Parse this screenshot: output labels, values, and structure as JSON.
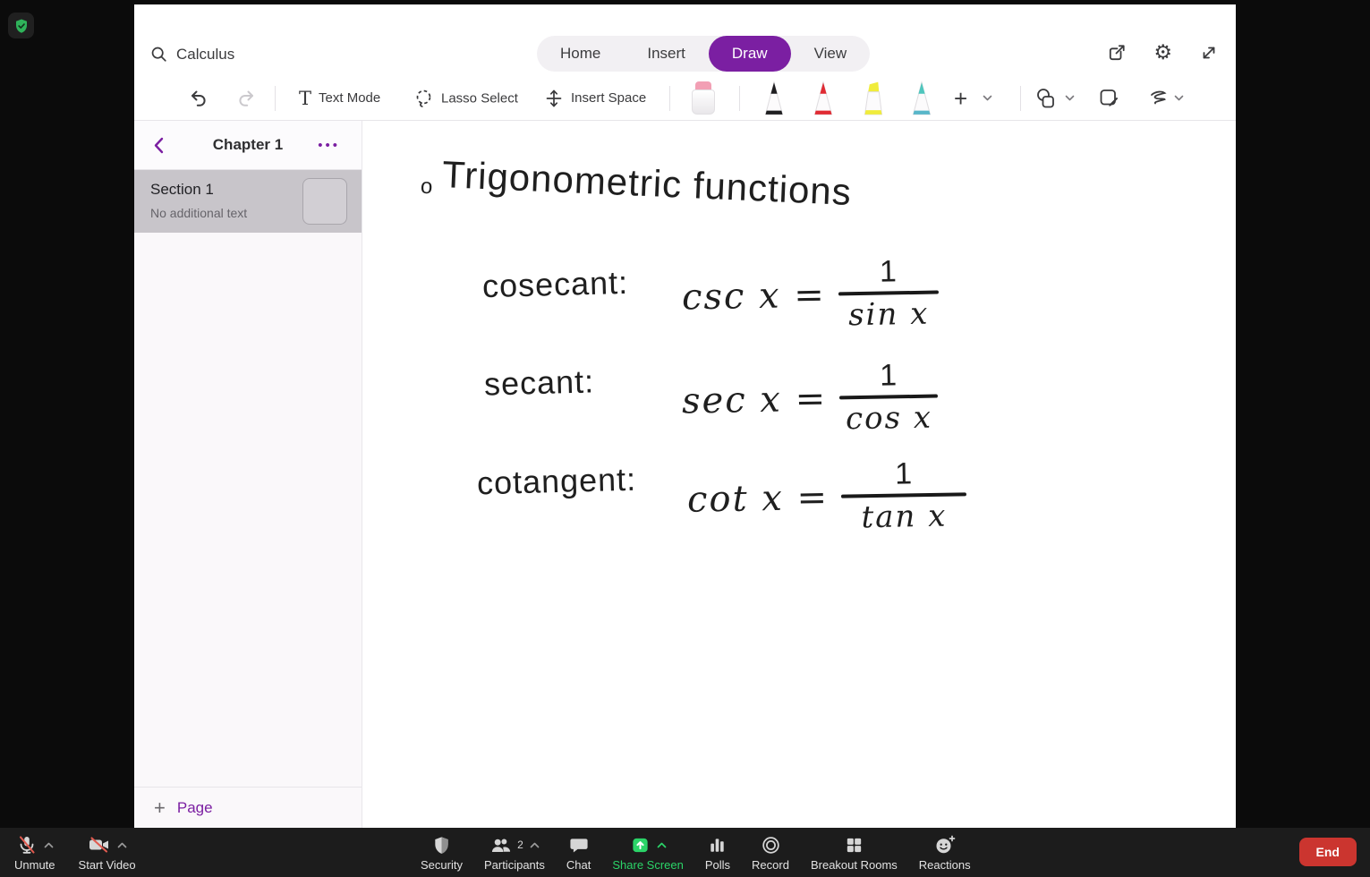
{
  "app": {
    "search": {
      "value": "Calculus"
    },
    "tabs": [
      "Home",
      "Insert",
      "Draw",
      "View"
    ],
    "active_tab": "Draw",
    "toolbar": {
      "text_mode": "Text Mode",
      "lasso_select": "Lasso Select",
      "insert_space": "Insert Space",
      "text_mode_glyph": "T",
      "plus": "+"
    },
    "sidebar": {
      "title": "Chapter 1",
      "menu_dots": "•••",
      "section": {
        "title": "Section 1",
        "subtitle": "No additional text"
      },
      "add_page": {
        "plus": "+",
        "label": "Page"
      }
    },
    "notes": {
      "bullet": "o",
      "title": "Trigonometric functions",
      "rows": [
        {
          "label": "cosecant:",
          "lhs": "csc x =",
          "num": "1",
          "den": "sin x"
        },
        {
          "label": "secant:",
          "lhs": "sec x =",
          "num": "1",
          "den": "cos x"
        },
        {
          "label": "cotangent:",
          "lhs": "cot x =",
          "num": "1",
          "den": "tan x"
        }
      ]
    },
    "colors": {
      "accent": "#7b1fa2",
      "ink": "#1f1f1f"
    }
  },
  "meeting": {
    "controls": {
      "unmute": "Unmute",
      "start_video": "Start Video",
      "security": "Security",
      "participants": "Participants",
      "participants_count": "2",
      "chat": "Chat",
      "share_screen": "Share Screen",
      "polls": "Polls",
      "record": "Record",
      "breakout_rooms": "Breakout Rooms",
      "reactions": "Reactions",
      "end": "End"
    },
    "gear_glyph": "⚙",
    "colors": {
      "share_green": "#2bd468",
      "end_red": "#cb352f",
      "slash_red": "#e05a4f"
    }
  }
}
